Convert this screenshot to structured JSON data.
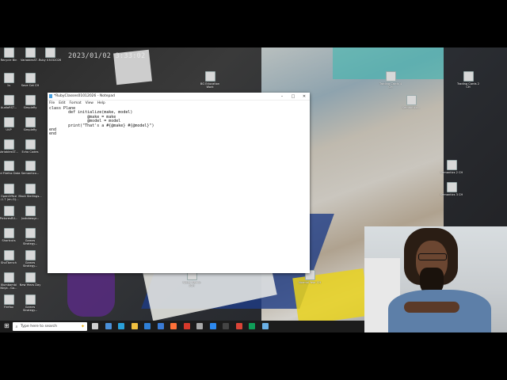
{
  "overlay": {
    "timestamp": "2023/01/02 3:33:02"
  },
  "desktop_icons": [
    {
      "label": "Recycle Bin"
    },
    {
      "label": "VariablesST..."
    },
    {
      "label": "Ruby 03032026"
    },
    {
      "label": "1s"
    },
    {
      "label": "Save Cat CH"
    },
    {
      "label": "AudioRST..."
    },
    {
      "label": "SimpleRy"
    },
    {
      "label": "UVP"
    },
    {
      "label": "SimpleRy"
    },
    {
      "label": "VariablesST..."
    },
    {
      "label": "Echo Codes"
    },
    {
      "label": "Old Firefox Data"
    },
    {
      "label": "Semantico..."
    },
    {
      "label": "OpenOffice 4.1.7 (en-G)..."
    },
    {
      "label": "Mack Stellings..."
    },
    {
      "label": "PicturesRU..."
    },
    {
      "label": "Justobeagr..."
    },
    {
      "label": "Shortcuts"
    },
    {
      "label": "Games Strategy..."
    },
    {
      "label": "ShoTbench"
    },
    {
      "label": "Games Strategy..."
    },
    {
      "label": "Illumbambi Ninja - Ga..."
    },
    {
      "label": "New Years Day"
    },
    {
      "label": "Firefox"
    },
    {
      "label": "Games Strategy..."
    },
    {
      "label": "BG Education Work"
    },
    {
      "label": "Trading Cards 4 CH"
    },
    {
      "label": "Trading Cards 2 CH"
    },
    {
      "label": "Semantico..."
    },
    {
      "label": "Semantics 2 CH"
    },
    {
      "label": "Semantics 3 CH"
    },
    {
      "label": "Composition Creative 4 CH"
    },
    {
      "label": "Bolo Prufsil"
    },
    {
      "label": "Semantico..."
    },
    {
      "label": "Nobel Ramin 2CH"
    },
    {
      "label": "Normal Year CH"
    },
    {
      "label": "Composition Creative 8CH"
    },
    {
      "label": "Composition Creative 2CH"
    }
  ],
  "notepad": {
    "title": "*RubyClasses01012026 - Notepad",
    "menu": [
      "File",
      "Edit",
      "Format",
      "View",
      "Help"
    ],
    "controls": [
      "–",
      "□",
      "✕"
    ],
    "text": "class Plane\n        def initialize(make, model)\n                @make = make\n                @model = model\n        print(\"That's a #{@make} #{@model}\")\nend\nend"
  },
  "taskbar": {
    "start_icon": "windows-logo",
    "search_placeholder": "Type here to search",
    "pinned": [
      {
        "name": "task-view-icon",
        "color": "#cfcfcf"
      },
      {
        "name": "widgets-icon",
        "color": "#4a90d9"
      },
      {
        "name": "edge-icon",
        "color": "#2aa0d8"
      },
      {
        "name": "file-explorer-icon",
        "color": "#f0c040"
      },
      {
        "name": "store-icon",
        "color": "#2f7fd6"
      },
      {
        "name": "mail-icon",
        "color": "#3a7bd5"
      },
      {
        "name": "firefox-icon",
        "color": "#ff7139"
      },
      {
        "name": "media-icon",
        "color": "#d8392b"
      },
      {
        "name": "app-icon",
        "color": "#aaaaaa"
      },
      {
        "name": "photos-icon",
        "color": "#2d89ef"
      },
      {
        "name": "terminal-icon",
        "color": "#444444"
      },
      {
        "name": "chrome-icon",
        "color": "#db4437"
      },
      {
        "name": "chrome-alt-icon",
        "color": "#0f9d58"
      },
      {
        "name": "notepad-icon",
        "color": "#6bb0e6"
      }
    ]
  }
}
